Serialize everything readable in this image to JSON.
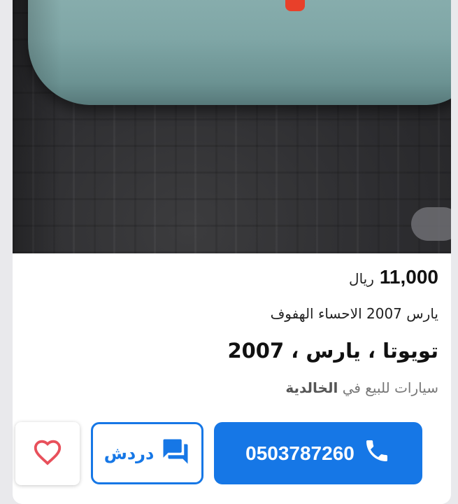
{
  "listing": {
    "price_value": "11,000",
    "price_currency": "ريال",
    "subtitle": "يارس 2007 الاحساء الهفوف",
    "title": "تويوتا  ، يارس ، 2007",
    "location_prefix": "سيارات للبيع في",
    "location_city": "الخالدية"
  },
  "actions": {
    "call_number": "0503787260",
    "chat_label": "دردش",
    "call_icon": "phone-icon",
    "chat_icon": "chat-icon",
    "favorite_icon": "heart-icon"
  },
  "colors": {
    "accent": "#1677e6",
    "favorite": "#e8505b",
    "text_primary": "#111111",
    "text_muted": "#777777"
  }
}
